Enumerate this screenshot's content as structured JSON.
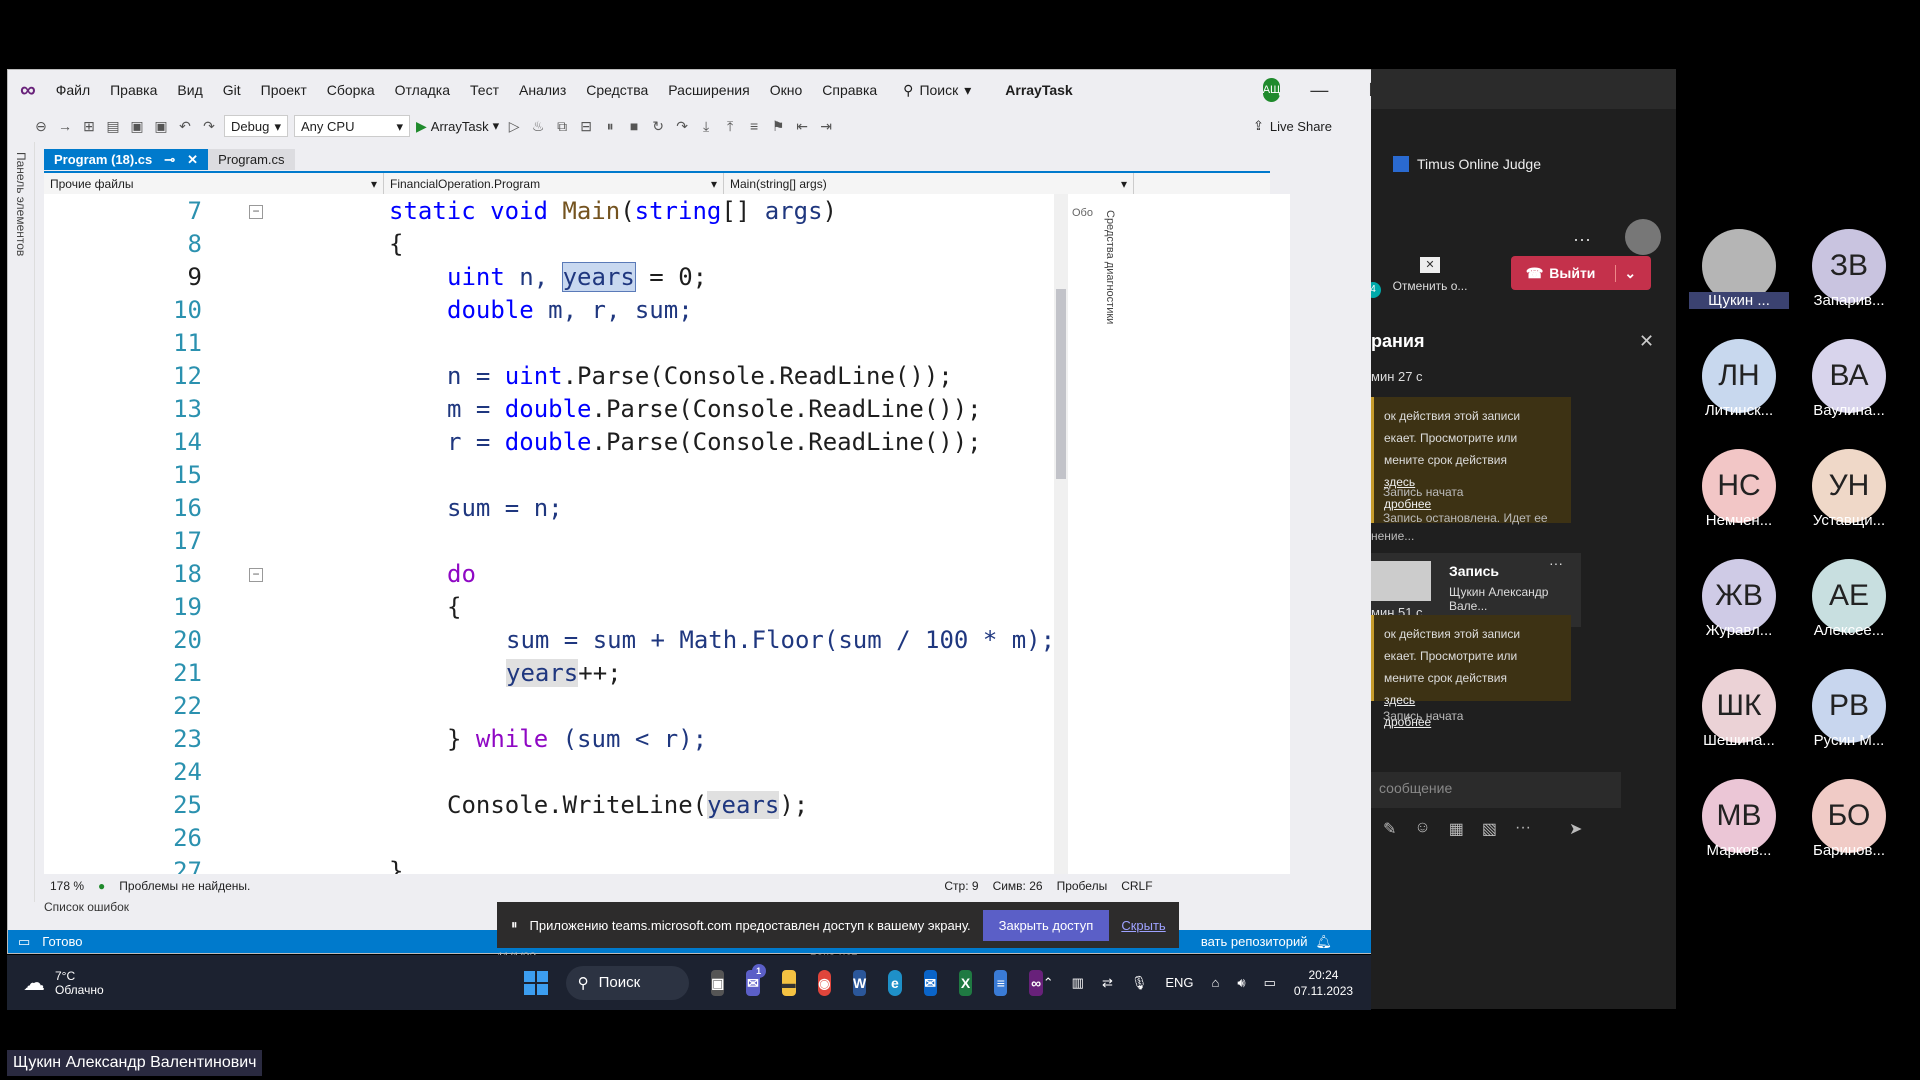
{
  "vs": {
    "menu": [
      "Файл",
      "Правка",
      "Вид",
      "Git",
      "Проект",
      "Сборка",
      "Отладка",
      "Тест",
      "Анализ",
      "Средства",
      "Расширения",
      "Окно",
      "Справка"
    ],
    "search_label": "Поиск",
    "solution_name": "ArrayTask",
    "user_initials": "АЩ",
    "toolbar": {
      "config": "Debug",
      "platform": "Any CPU",
      "run_target": "ArrayTask",
      "live_share": "Live Share"
    },
    "left_strip": "Панель элементов",
    "tabs": [
      {
        "label": "Program (18).cs",
        "active": true
      },
      {
        "label": "Program.cs",
        "active": false
      }
    ],
    "nav": {
      "project": "Прочие файлы",
      "class": "FinancialOperation.Program",
      "member": "Main(string[] args)"
    },
    "line_numbers": [
      "7",
      "8",
      "9",
      "10",
      "11",
      "12",
      "13",
      "14",
      "15",
      "16",
      "17",
      "18",
      "19",
      "20",
      "21",
      "22",
      "23",
      "24",
      "25",
      "26",
      "27"
    ],
    "side_label_right": "Средства диагностики",
    "side_short": "Обо",
    "status": {
      "zoom": "178 %",
      "problems": "Проблемы не найдены.",
      "line": "Стр: 9",
      "col": "Симв: 26",
      "spaces": "Пробелы",
      "eol": "CRLF"
    },
    "error_list": "Список ошибок",
    "ready": "Готово",
    "repo": "вать репозиторий"
  },
  "code": {
    "l7": {
      "kw1": "static",
      "kw2": "void",
      "meth": "Main",
      "p1": "(",
      "ty": "string",
      "p2": "[] ",
      "var": "args",
      "p3": ")"
    },
    "l8": "{",
    "l9": {
      "kw": "uint",
      "a": " n, ",
      "sel": "years",
      "b": " = 0;"
    },
    "l10": {
      "kw": "double",
      "a": " m, r, sum;"
    },
    "l12": {
      "a": "n = ",
      "kw": "uint",
      "b": ".Parse(Console.ReadLine());"
    },
    "l13": {
      "a": "m = ",
      "kw": "double",
      "b": ".Parse(Console.ReadLine());"
    },
    "l14": {
      "a": "r = ",
      "kw": "double",
      "b": ".Parse(Console.ReadLine());"
    },
    "l16": "sum = n;",
    "l18": "do",
    "l19": "{",
    "l20": "sum = sum + Math.Floor(sum / 100 * m);",
    "l21": {
      "ref": "years",
      "a": "++;"
    },
    "l23": {
      "a": "} ",
      "kw": "while",
      "b": " (sum < r);"
    },
    "l25": {
      "a": "Console.WriteLine(",
      "ref": "years",
      "b": ");"
    },
    "l27": "}"
  },
  "share_banner": {
    "text": "Приложению teams.microsoft.com предоставлен доступ к вашему экрану.",
    "stop": "Закрыть доступ",
    "hide": "Скрыть",
    "behind1": "11/1/23",
    "behind2": "пока нет"
  },
  "taskbar": {
    "temp": "7°C",
    "weather": "Облачно",
    "search": "Поиск",
    "lang": "ENG",
    "time": "20:24",
    "date": "07.11.2023",
    "chat_badge": "1"
  },
  "teams": {
    "tab_title": "Timus Online Judge",
    "cancel_rec": "Отменить о...",
    "leave": "Выйти",
    "panel_title": "рания",
    "time1": "мин 27 с",
    "notice_text": "ок действия этой записи\nекает. Просмотрите или\nмените срок действия",
    "notice_link1": "здесь",
    "notice_link2": "дробнее",
    "rec_started": "Запись начата",
    "rec_stopped": "Запись остановлена. Идет ее",
    "rec_stopped2": "нение...",
    "rec_title": "Запись",
    "rec_owner": "Щукин Александр Вале...",
    "time2": "мин 51 с",
    "rec_started2": "Запись начата",
    "msg_placeholder": "сообщение",
    "notify_badge": "4"
  },
  "participants": [
    {
      "initials": "",
      "name": "Щукин ...",
      "color": "#b5b5b5",
      "selected": true
    },
    {
      "initials": "ЗВ",
      "name": "Запарив...",
      "color": "#c9c4e0"
    },
    {
      "initials": "ЛН",
      "name": "Литинск...",
      "color": "#c8d8ee"
    },
    {
      "initials": "ВА",
      "name": "Ваулина...",
      "color": "#d8d4ec"
    },
    {
      "initials": "НС",
      "name": "Немчен...",
      "color": "#f2c6c6"
    },
    {
      "initials": "УН",
      "name": "Уставщи...",
      "color": "#efd8c8"
    },
    {
      "initials": "ЖВ",
      "name": "Журавл...",
      "color": "#cfcbe6"
    },
    {
      "initials": "АЕ",
      "name": "Алексее...",
      "color": "#c8dfe0"
    },
    {
      "initials": "ШК",
      "name": "Шешина...",
      "color": "#ebd2d6"
    },
    {
      "initials": "РВ",
      "name": "Русин М...",
      "color": "#c8d6ee"
    },
    {
      "initials": "МВ",
      "name": "Марков...",
      "color": "#ebc6d6"
    },
    {
      "initials": "БО",
      "name": "Баринов...",
      "color": "#f0cbc6"
    }
  ],
  "presenter": "Щукин Александр Валентинович"
}
